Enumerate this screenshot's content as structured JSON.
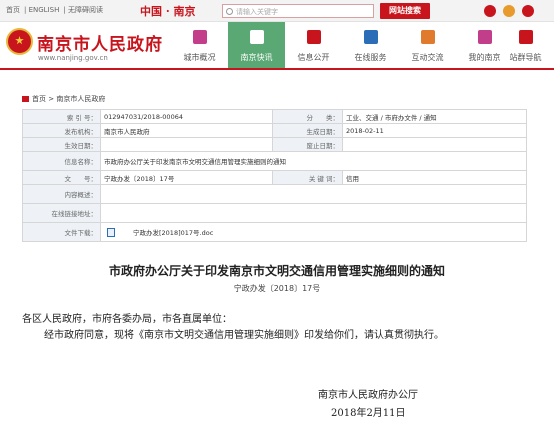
{
  "topbar": {
    "links": [
      "首页",
      "ENGLISH",
      "无障碍阅读"
    ],
    "brand": "中国 · 南京",
    "search_placeholder": "请输入关键字",
    "search_button": "网站搜索",
    "social_icons": [
      "weibo-icon",
      "rss-icon",
      "wechat-icon"
    ]
  },
  "header": {
    "title": "南京市人民政府",
    "url": "www.nanjing.gov.cn"
  },
  "nav": {
    "items": [
      {
        "label": "城市概况",
        "icon": "building-icon"
      },
      {
        "label": "南京快讯",
        "icon": "news-icon"
      },
      {
        "label": "信息公开",
        "icon": "info-icon"
      },
      {
        "label": "在线服务",
        "icon": "thumb-icon"
      },
      {
        "label": "互动交流",
        "icon": "chat-icon"
      },
      {
        "label": "我的南京",
        "icon": "flower-icon"
      },
      {
        "label": "站群导航",
        "icon": "person-icon"
      }
    ],
    "active_index": 1
  },
  "breadcrumb": {
    "home": "首页",
    "current": "南京市人民政府"
  },
  "meta": {
    "rows": [
      {
        "l1": "索 引 号：",
        "v1": "012947031/2018-00064",
        "l2": "分　　类：",
        "v2": "工业、交通 / 市府办文件 / 通知"
      },
      {
        "l1": "发布机构：",
        "v1": "南京市人民政府",
        "l2": "生成日期：",
        "v2": "2018-02-11"
      },
      {
        "l1": "生效日期：",
        "v1": "",
        "l2": "废止日期：",
        "v2": ""
      },
      {
        "l1": "信息名称：",
        "v1": "市政府办公厅关于印发南京市文明交通信用管理实施细则的通知"
      },
      {
        "l1": "文　　号：",
        "v1": "宁政办发〔2018〕17号",
        "l2": "关 键 词：",
        "v2": "信用"
      },
      {
        "l1": "内容概述：",
        "v1": ""
      },
      {
        "l1": "在线链接地址：",
        "v1": ""
      },
      {
        "l1": "文件下载：",
        "v1": "宁政办发[2018]017号.doc"
      }
    ]
  },
  "article": {
    "title": "市政府办公厅关于印发南京市文明交通信用管理实施细则的通知",
    "doc_number": "宁政办发〔2018〕17号",
    "salutation": "各区人民政府，市府各委办局，市各直属单位：",
    "body": "经市政府同意，现将《南京市文明交通信用管理实施细则》印发给你们，请认真贯彻执行。",
    "signature": "南京市人民政府办公厅",
    "date": "2018年2月11日"
  }
}
